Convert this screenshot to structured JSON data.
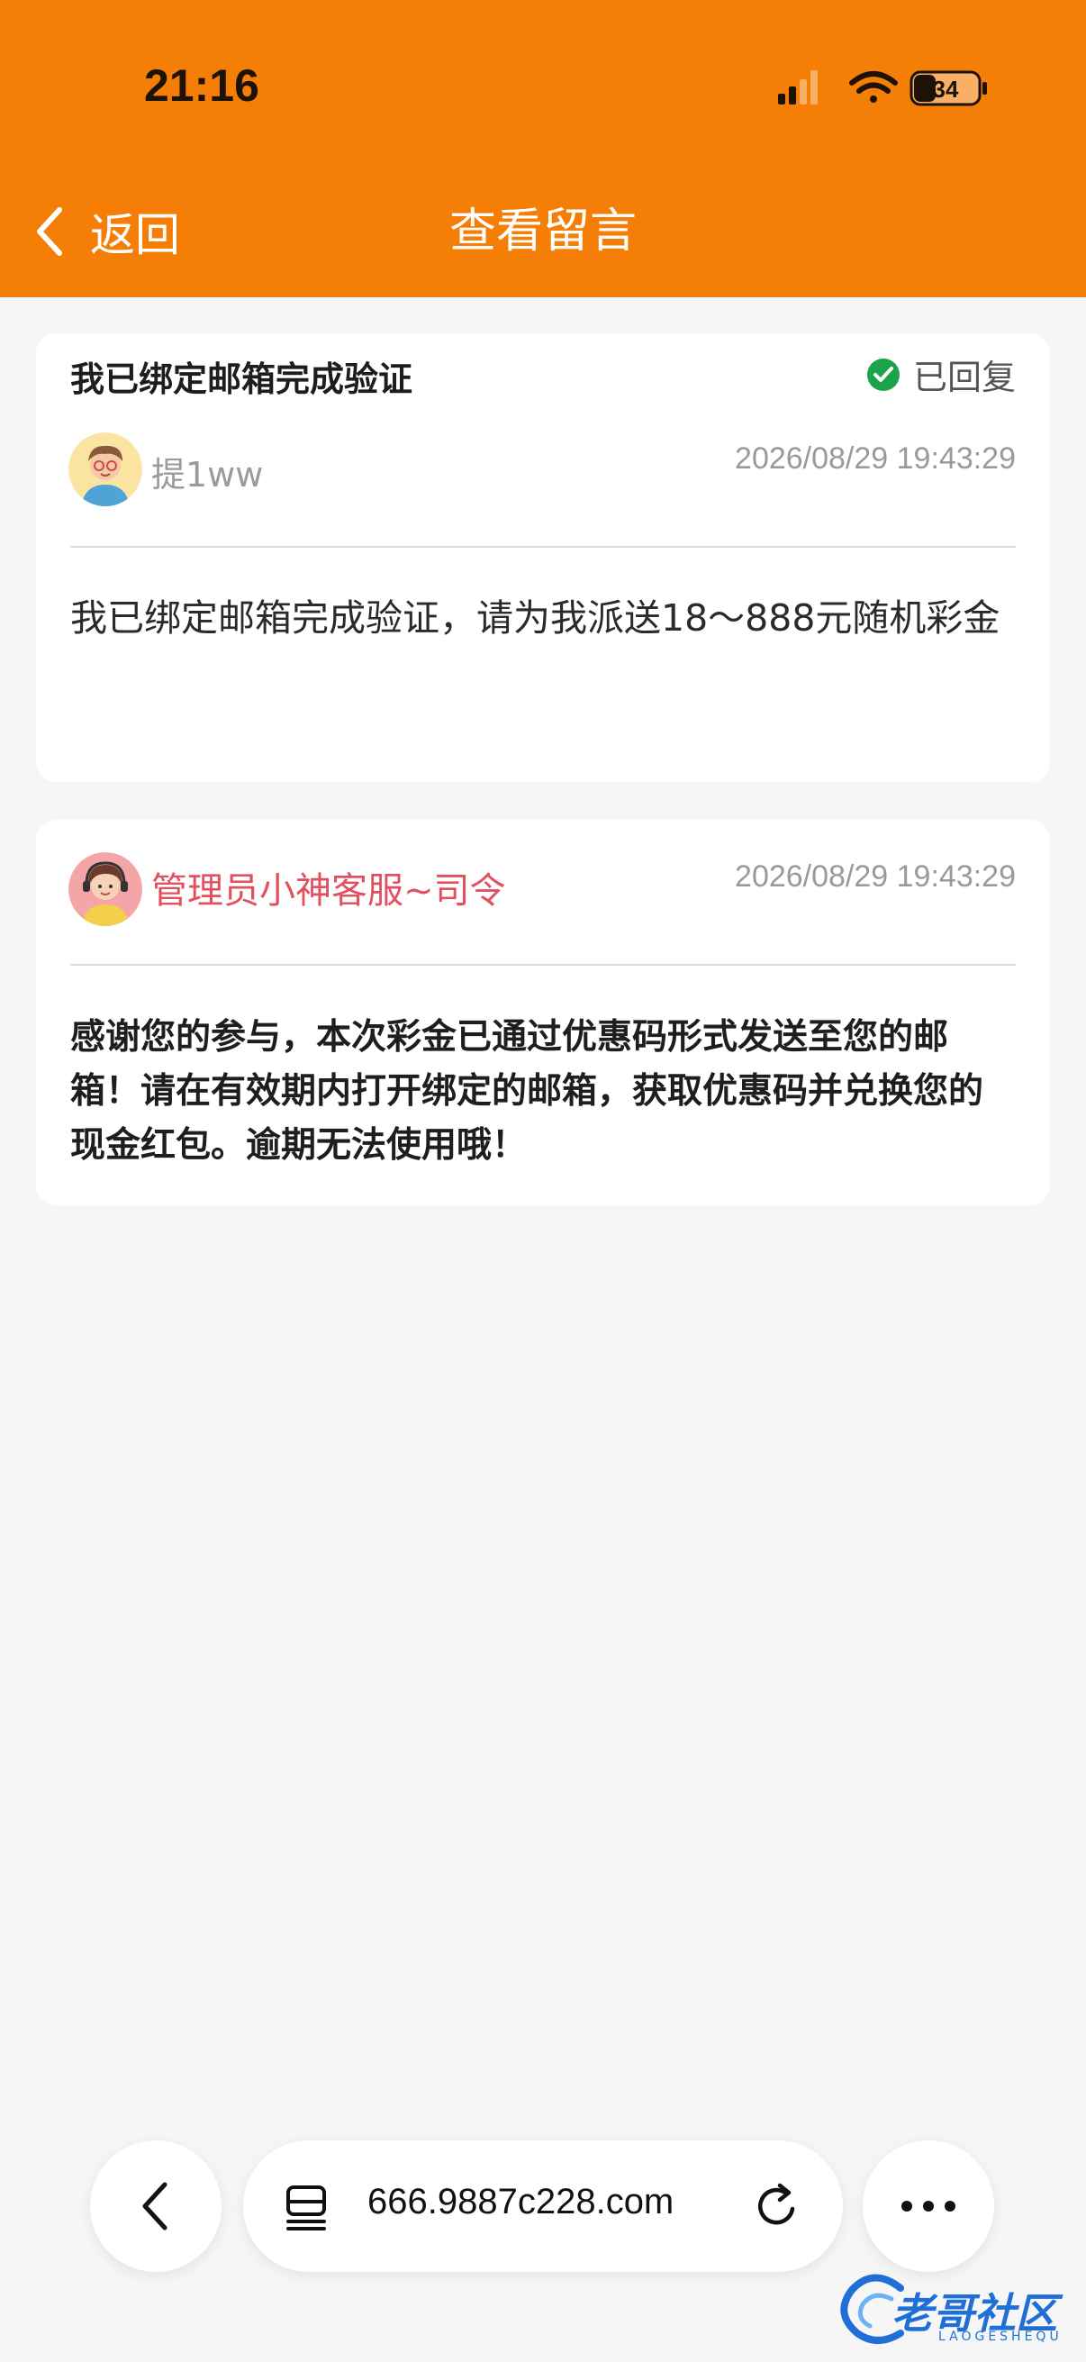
{
  "status_bar": {
    "time": "21:16",
    "battery": "34"
  },
  "header": {
    "back_label": "返回",
    "title": "查看留言"
  },
  "topic": {
    "title": "我已绑定邮箱完成验证",
    "status": "已回复",
    "author": "提1ww",
    "timestamp": "2026/08/29 19:43:29",
    "message": "我已绑定邮箱完成验证，请为我派送18～888元随机彩金"
  },
  "reply": {
    "author": "管理员小神客服~司令",
    "timestamp": "2026/08/29 19:43:29",
    "message": "感谢您的参与，本次彩金已通过优惠码形式发送至您的邮箱！请在有效期内打开绑定的邮箱，获取优惠码并兑换您的现金红包。逾期无法使用哦！"
  },
  "browser": {
    "url": "666.9887c228.com"
  },
  "watermark": {
    "text": "老哥社区",
    "sub": "LAOGESHEQU"
  },
  "colors": {
    "accent": "#f57f06",
    "admin": "#e25060",
    "check": "#1aa34a"
  }
}
